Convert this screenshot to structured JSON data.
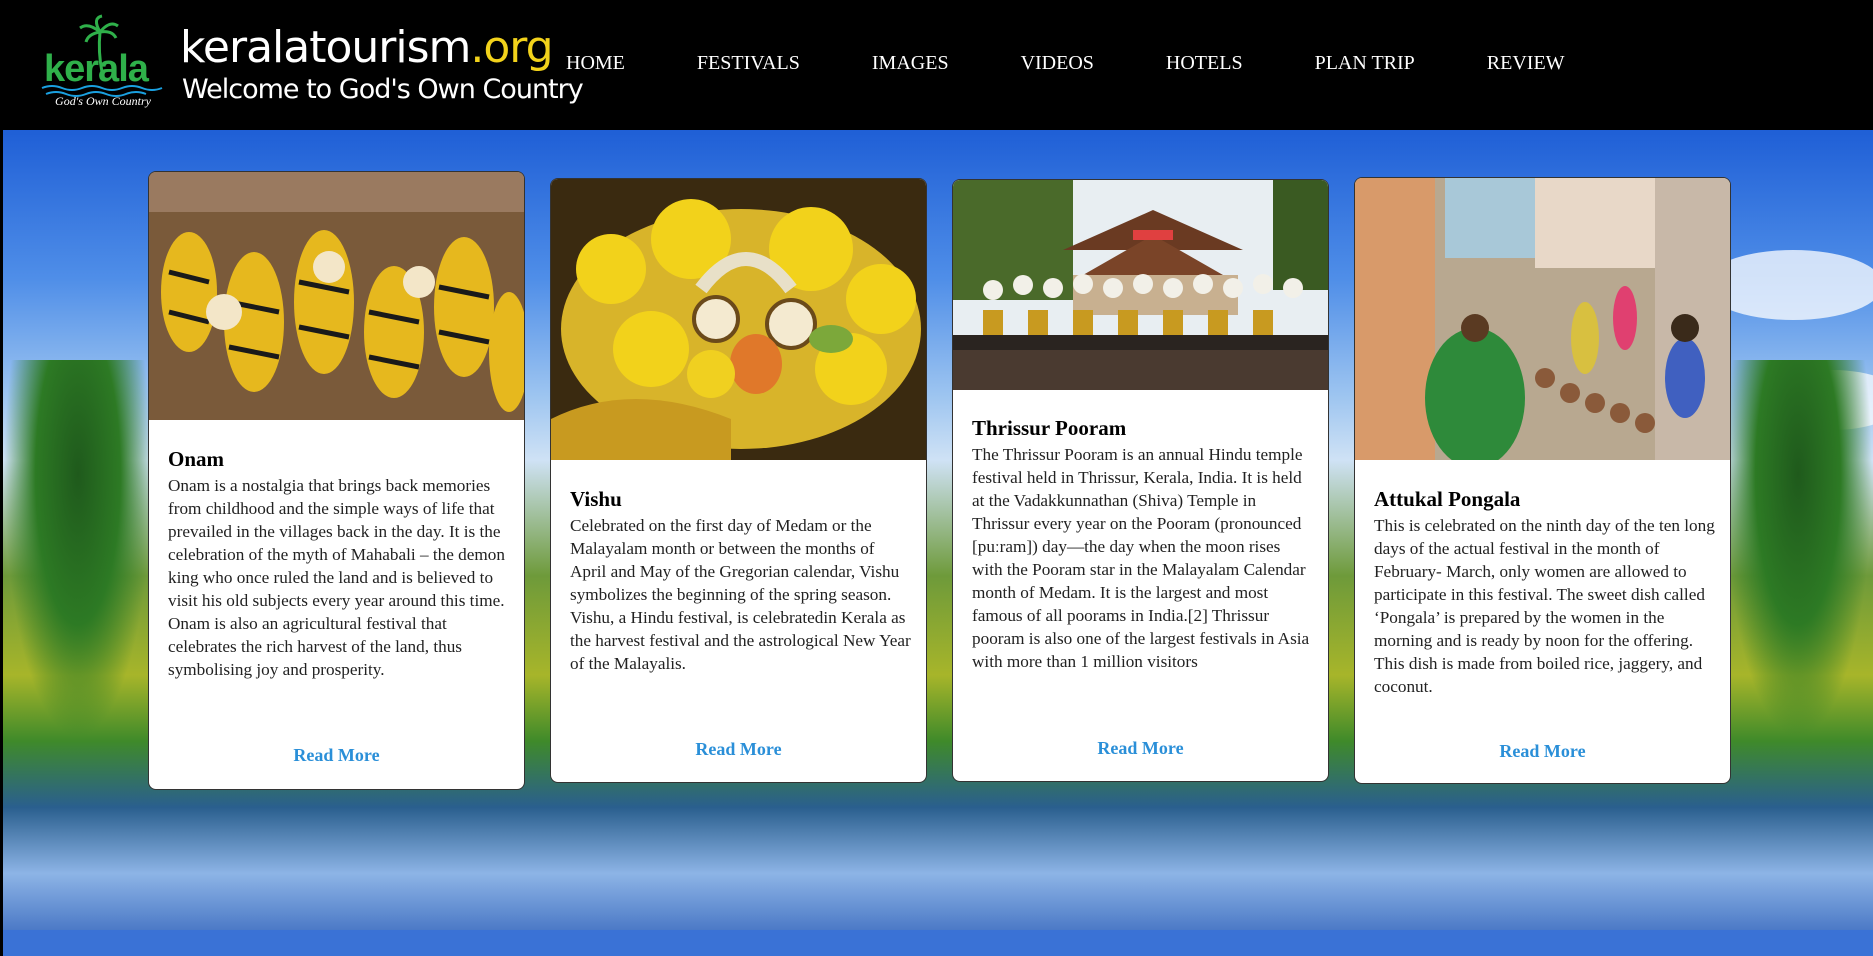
{
  "header": {
    "logo_text": "kerala",
    "logo_tagline": "God's Own Country",
    "site_name": "keralatourism",
    "site_tld": ".org",
    "site_tagline": "Welcome to God's Own Country"
  },
  "nav": {
    "items": [
      "HOME",
      "FESTIVALS",
      "IMAGES",
      "VIDEOS",
      "HOTELS",
      "PLAN TRIP",
      "REVIEW"
    ]
  },
  "cards": [
    {
      "title": "Onam",
      "text": "Onam is a nostalgia that brings back memories from childhood and the simple ways of life that prevailed in the villages back in the day. It is the celebration of the myth of Mahabali – the demon king who once ruled the land and is believed to visit his old subjects every year around this time. Onam is also an agricultural festival that celebrates the rich harvest of the land, thus symbolising joy and prosperity.",
      "link": "Read More"
    },
    {
      "title": "Vishu",
      "text": "Celebrated on the first day of Medam or the Malayalam month or between the months of April and May of the Gregorian calendar, Vishu symbolizes the beginning of the spring season. Vishu, a Hindu festival, is celebratedin Kerala as the harvest festival and the astrological New Year of the Malayalis.",
      "link": "Read More"
    },
    {
      "title": "Thrissur Pooram",
      "text": "The Thrissur Pooram is an annual Hindu temple festival held in Thrissur, Kerala, India. It is held at the Vadakkunnathan (Shiva) Temple in Thrissur every year on the Pooram (pronounced [puːram]) day—the day when the moon rises with the Pooram star in the Malayalam Calendar month of Medam. It is the largest and most famous of all poorams in India.[2] Thrissur pooram is also one of the largest festivals in Asia with more than 1 million visitors",
      "link": "Read More"
    },
    {
      "title": "Attukal Pongala",
      "text": "This is celebrated on the ninth day of the ten long days of the actual festival in the month of February- March, only women are allowed to participate in this festival. The sweet dish called ‘Pongala’ is prepared by the women in the morning and is ready by noon for the offering. This dish is made from boiled rice, jaggery, and coconut.",
      "link": "Read More"
    }
  ],
  "colors": {
    "header_bg": "#000000",
    "link": "#2a8fd8",
    "logo_green": "#2fb04a",
    "tld_yellow": "#f2d21b"
  }
}
